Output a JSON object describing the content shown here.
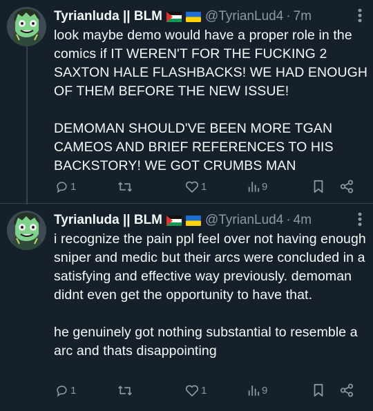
{
  "tweets": [
    {
      "author": {
        "name": "Tyrianluda || BLM",
        "handle": "@TyrianLud4",
        "flags": [
          "palestine-flag",
          "ukraine-flag"
        ]
      },
      "separator": "·",
      "time": "7m",
      "text": "look maybe demo would have a proper role in the comics if IT WEREN'T FOR THE FUCKING 2 SAXTON HALE FLASHBACKS! WE HAD ENOUGH OF THEM BEFORE THE NEW ISSUE!\n\nDEMOMAN SHOULD'VE BEEN MORE TGAN CAMEOS AND BRIEF REFERENCES TO HIS BACKSTORY! WE GOT CRUMBS MAN",
      "stats": {
        "replies": "1",
        "retweets": "",
        "likes": "1",
        "views": "9"
      }
    },
    {
      "author": {
        "name": "Tyrianluda || BLM",
        "handle": "@TyrianLud4",
        "flags": [
          "palestine-flag",
          "ukraine-flag"
        ]
      },
      "separator": "·",
      "time": "4m",
      "text": "i recognize the pain ppl feel over not having enough sniper and medic but their arcs were concluded in a satisfying and effective way previously. demoman didnt even get the opportunity to have that.\n\nhe genuinely got nothing substantial to resemble a arc and thats disappointing",
      "stats": {
        "replies": "1",
        "retweets": "",
        "likes": "1",
        "views": "9"
      }
    }
  ],
  "colors": {
    "background": "#15202b",
    "text": "#f7f9f9",
    "muted": "#8b98a5",
    "border": "#38444d"
  }
}
